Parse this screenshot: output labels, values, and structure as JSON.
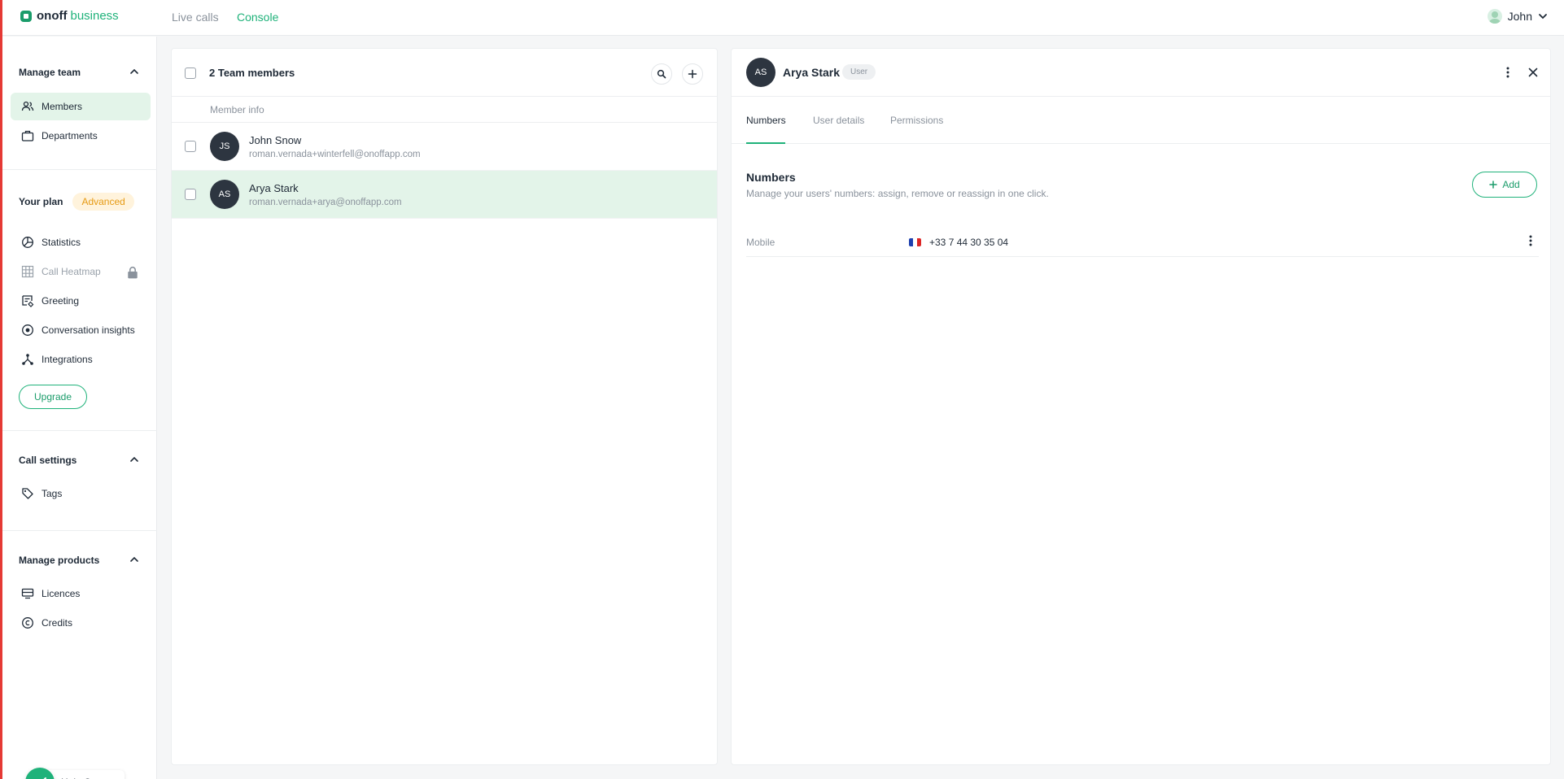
{
  "app": {
    "brand_bold": "onoff",
    "brand_light": "business",
    "nav": [
      {
        "label": "Live calls",
        "active": false
      },
      {
        "label": "Console",
        "active": true
      }
    ],
    "user": "John",
    "accent_color": "#1fb27a"
  },
  "sidebar": {
    "manage_team": {
      "title": "Manage team",
      "items": [
        {
          "label": "Members",
          "icon": "members-icon",
          "active": true
        },
        {
          "label": "Departments",
          "icon": "briefcase-icon"
        }
      ]
    },
    "plan": {
      "title": "Your plan",
      "badge": "Advanced",
      "items": [
        {
          "label": "Statistics",
          "icon": "pie-chart-icon"
        },
        {
          "label": "Call Heatmap",
          "icon": "grid-icon",
          "locked": true
        },
        {
          "label": "Greeting",
          "icon": "greeting-icon"
        },
        {
          "label": "Conversation insights",
          "icon": "insights-icon"
        },
        {
          "label": "Integrations",
          "icon": "integrations-icon"
        }
      ],
      "upgrade_label": "Upgrade"
    },
    "call_settings": {
      "title": "Call settings",
      "items": [
        {
          "label": "Tags",
          "icon": "tag-icon"
        }
      ]
    },
    "manage_products": {
      "title": "Manage products",
      "items": [
        {
          "label": "Licences",
          "icon": "licence-icon"
        },
        {
          "label": "Credits",
          "icon": "copyright-icon"
        }
      ]
    },
    "help_label": "Help Center"
  },
  "members": {
    "title": "2 Team members",
    "column_header": "Member info",
    "rows": [
      {
        "initials": "JS",
        "name": "John Snow",
        "email": "roman.vernada+winterfell@onoffapp.com",
        "selected": false
      },
      {
        "initials": "AS",
        "name": "Arya Stark",
        "email": "roman.vernada+arya@onoffapp.com",
        "selected": true
      }
    ]
  },
  "details": {
    "initials": "AS",
    "name": "Arya Stark",
    "role": "User",
    "tabs": [
      {
        "label": "Numbers",
        "active": true
      },
      {
        "label": "User details",
        "active": false
      },
      {
        "label": "Permissions",
        "active": false
      }
    ],
    "section_title": "Numbers",
    "section_desc": "Manage your users' numbers: assign, remove or reassign in one click.",
    "add_label": "Add",
    "numbers": [
      {
        "type": "Mobile",
        "country": "FR",
        "value": "+33 7 44 30 35 04"
      }
    ]
  }
}
